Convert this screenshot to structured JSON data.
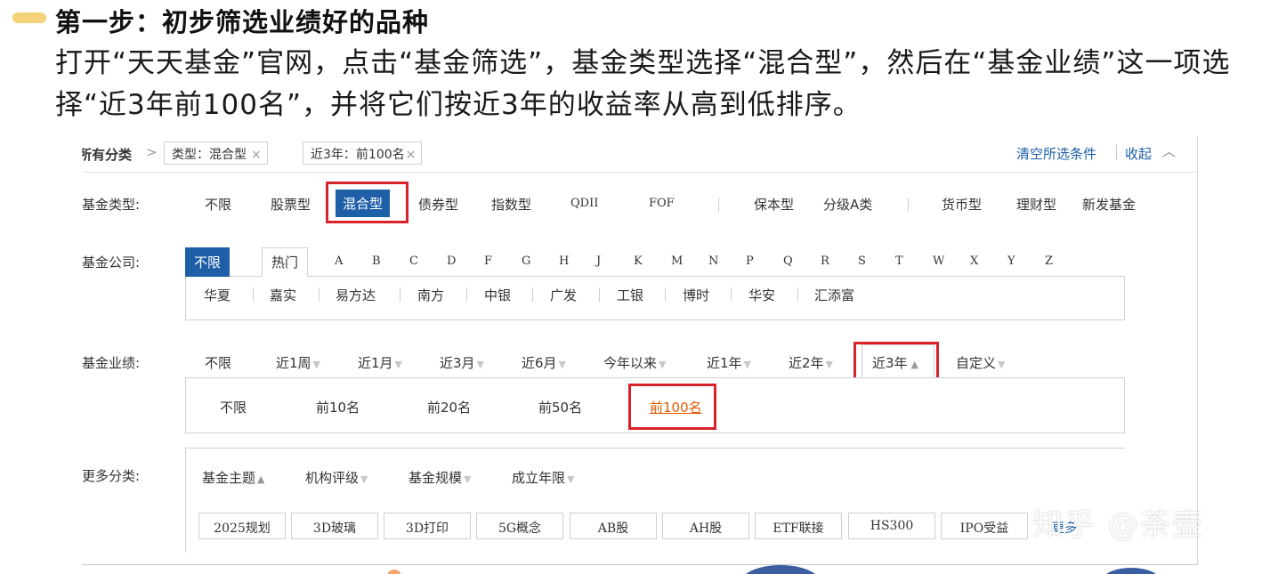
{
  "heading": {
    "title": "第一步：初步筛选业绩好的品种",
    "intro": "打开“天天基金”官网，点击“基金筛选”，基金类型选择“混合型”，然后在“基金业绩”这一项选择“近3年前100名”，并将它们按近3年的收益率从高到低排序。"
  },
  "filter_bar": {
    "label": "所有分类",
    "sep": ">",
    "chips": [
      {
        "text": "类型：混合型",
        "close": "×"
      },
      {
        "text": "近3年：前100名",
        "close": "×"
      }
    ],
    "clear": "清空所选条件",
    "collapse": "收起",
    "collapse_icon": "^"
  },
  "fund_type": {
    "label": "基金类型:",
    "options": [
      "不限",
      "股票型",
      "混合型",
      "债券型",
      "指数型",
      "QDII",
      "FOF",
      "保本型",
      "分级A类",
      "货币型",
      "理财型",
      "新发基金"
    ],
    "selected": "混合型"
  },
  "fund_company": {
    "label": "基金公司:",
    "tabs": [
      "不限",
      "热门"
    ],
    "letters": [
      "A",
      "B",
      "C",
      "D",
      "F",
      "G",
      "H",
      "J",
      "K",
      "M",
      "N",
      "P",
      "Q",
      "R",
      "S",
      "T",
      "W",
      "X",
      "Y",
      "Z"
    ],
    "companies": [
      "华夏",
      "嘉实",
      "易方达",
      "南方",
      "中银",
      "广发",
      "工银",
      "博时",
      "华安",
      "汇添富"
    ]
  },
  "fund_performance": {
    "label": "基金业绩:",
    "options": [
      "不限",
      "近1周",
      "近1月",
      "近3月",
      "近6月",
      "今年以来",
      "近1年",
      "近2年",
      "近3年",
      "自定义"
    ],
    "selected": "近3年",
    "ranks": [
      "不限",
      "前10名",
      "前20名",
      "前50名",
      "前100名"
    ],
    "selected_rank": "前100名"
  },
  "more_categories": {
    "label": "更多分类:",
    "tabs": [
      "基金主题",
      "机构评级",
      "基金规模",
      "成立年限"
    ],
    "tags": [
      "2025规划",
      "3D玻璃",
      "3D打印",
      "5G概念",
      "AB股",
      "AH股",
      "ETF联接",
      "HS300",
      "IPO受益"
    ],
    "more": "更多"
  },
  "watermark": "知乎 @茶壶",
  "colors": {
    "accent_blue": "#1f5fa8",
    "highlight_red": "#d9232b",
    "rank_orange": "#e05a00",
    "bullet_yellow": "#f3d27a"
  }
}
